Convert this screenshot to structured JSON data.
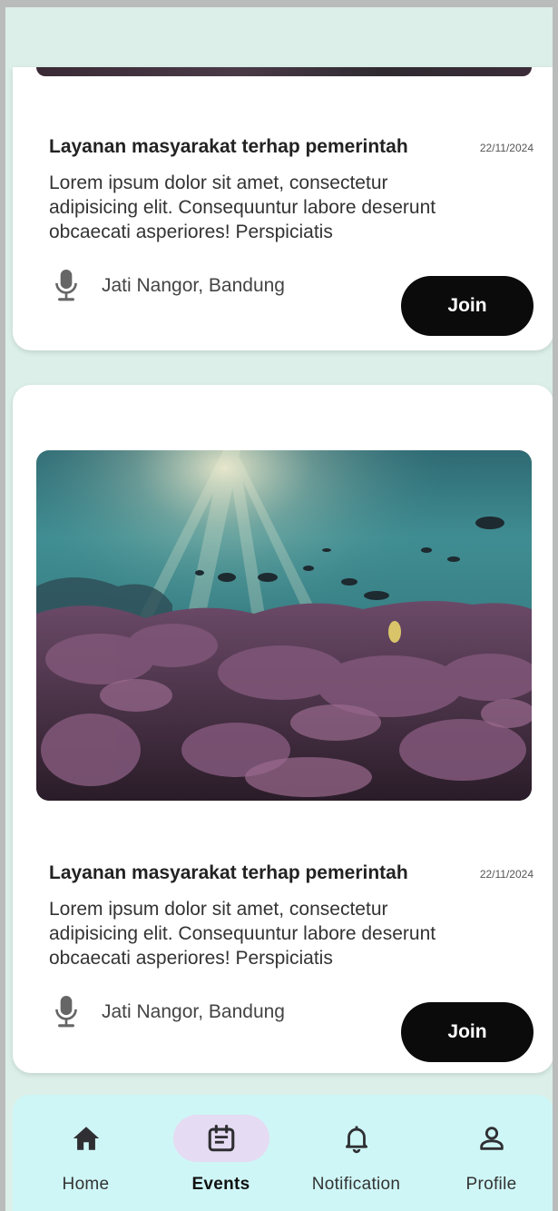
{
  "cards": [
    {
      "title": "Layanan masyarakat terhap pemerintah",
      "date": "22/11/2024",
      "description": "Lorem ipsum dolor sit amet, consectetur adipisicing elit. Consequuntur labore deserunt obcaecati asperiores! Perspiciatis",
      "location": "Jati Nangor, Bandung",
      "join_label": "Join"
    },
    {
      "title": "Layanan masyarakat terhap pemerintah",
      "date": "22/11/2024",
      "description": "Lorem ipsum dolor sit amet, consectetur adipisicing elit. Consequuntur labore deserunt obcaecati asperiores! Perspiciatis",
      "location": "Jati Nangor, Bandung",
      "join_label": "Join"
    }
  ],
  "nav": {
    "items": [
      {
        "label": "Home",
        "icon": "home-icon",
        "active": false
      },
      {
        "label": "Events",
        "icon": "events-icon",
        "active": true
      },
      {
        "label": "Notification",
        "icon": "bell-icon",
        "active": false
      },
      {
        "label": "Profile",
        "icon": "profile-icon",
        "active": false
      }
    ]
  },
  "colors": {
    "background": "#dcefe9",
    "navbar": "#cff6f6",
    "active_pill": "#e5dbf2",
    "button": "#0b0b0b"
  }
}
